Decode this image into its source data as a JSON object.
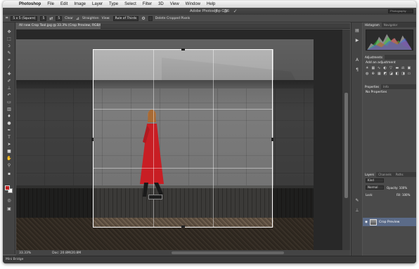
{
  "menubar": {
    "apple": "",
    "items": [
      "Photoshop",
      "File",
      "Edit",
      "Image",
      "Layer",
      "Type",
      "Select",
      "Filter",
      "3D",
      "View",
      "Window",
      "Help"
    ]
  },
  "window": {
    "title": "Adobe Photoshop CS6",
    "workspace": "Photography"
  },
  "options": {
    "ratio": "5 x 5 (Square)",
    "width": "5",
    "height": "5",
    "clear": "Clear",
    "straighten": "Straighten",
    "view_label": "View:",
    "view_value": "Rule of Thirds",
    "delete_cropped": "Delete Cropped Pixels"
  },
  "document": {
    "tab": "All new Crop Tool.jpg @ 33.3% (Crop Preview, RGB/8*)"
  },
  "status": {
    "zoom": "33.33%",
    "doc": "Doc: 20.8M/20.8M"
  },
  "minibridge": "Mini Bridge",
  "panels": {
    "top_tabs": [
      "Histogram",
      "Navigator"
    ],
    "adjustments_tab": "Adjustments",
    "add_adjustment": "Add an adjustment",
    "mid_tabs": [
      "Properties",
      "Info"
    ],
    "no_properties": "No Properties",
    "layers_tabs": [
      "Layers",
      "Channels",
      "Paths"
    ],
    "kind": "Kind",
    "blend": "Normal",
    "opacity": "Opacity: 100%",
    "lock": "Lock:",
    "fill": "Fill: 100%",
    "layer_name": "Crop Preview"
  }
}
